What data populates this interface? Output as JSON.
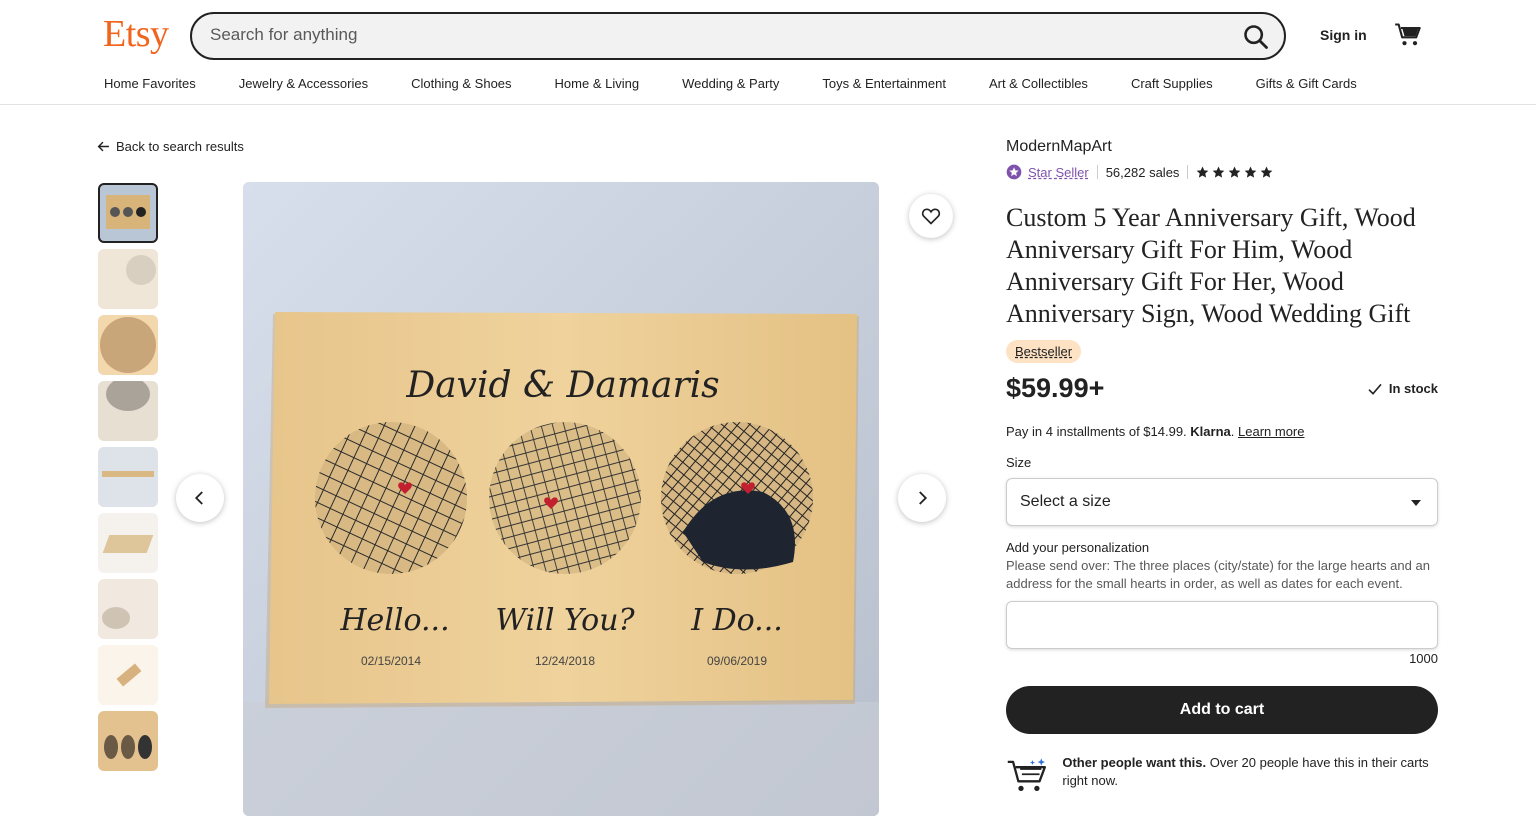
{
  "header": {
    "logo": "Etsy",
    "search_placeholder": "Search for anything",
    "signin": "Sign in"
  },
  "nav": [
    "Home Favorites",
    "Jewelry & Accessories",
    "Clothing & Shoes",
    "Home & Living",
    "Wedding & Party",
    "Toys & Entertainment",
    "Art & Collectibles",
    "Craft Supplies",
    "Gifts & Gift Cards"
  ],
  "back_label": "Back to search results",
  "product_image": {
    "names": "David & Damaris",
    "captions": [
      "Hello...",
      "Will You?",
      "I Do..."
    ],
    "dates": [
      "02/15/2014",
      "12/24/2018",
      "09/06/2019"
    ]
  },
  "listing": {
    "shop_name": "ModernMapArt",
    "star_seller": "Star Seller",
    "sales": "56,282 sales",
    "rating": 5,
    "title": "Custom 5 Year Anniversary Gift, Wood Anniversary Gift For Him, Wood Anniversary Gift For Her, Wood Anniversary Sign, Wood Wedding Gift",
    "badge": "Bestseller",
    "price": "$59.99+",
    "stock": "In stock",
    "klarna_prefix": "Pay in 4 installments of $14.99.",
    "klarna_brand": "Klarna",
    "klarna_link": "Learn more",
    "size_label": "Size",
    "size_value": "Select a size",
    "personalization_label": "Add your personalization",
    "personalization_help": "Please send over: The three places (city/state) for the large hearts and an address for the small hearts in order, as well as dates for each event.",
    "char_count": "1000",
    "add_to_cart": "Add to cart",
    "others_bold": "Other people want this.",
    "others_text": "Over 20 people have this in their carts right now."
  },
  "colors": {
    "brand": "#f1641e",
    "star_seller": "#7f53ac",
    "badge_bg": "#fde2c4",
    "button_bg": "#222222"
  }
}
